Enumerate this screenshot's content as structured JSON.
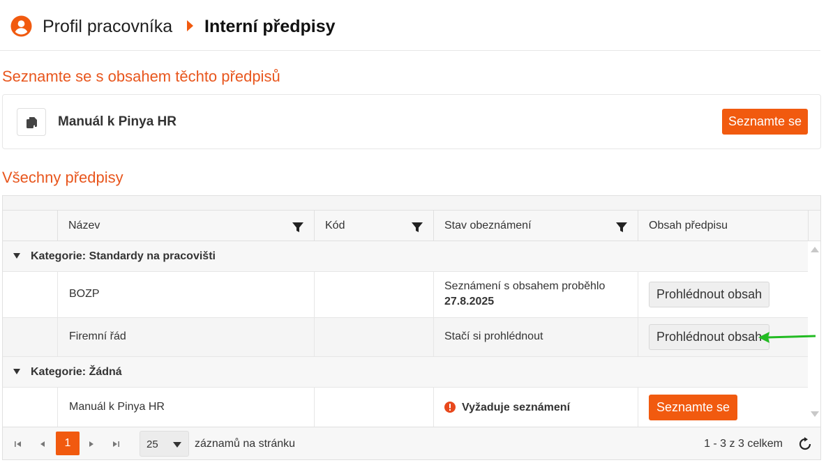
{
  "breadcrumb": {
    "parent": "Profil pracovníka",
    "current": "Interní předpisy"
  },
  "acknowledge_section": {
    "title": "Seznamte se s obsahem těchto předpisů",
    "item_name": "Manuál k Pinya HR",
    "button_label": "Seznamte se"
  },
  "all_section": {
    "title": "Všechny předpisy"
  },
  "grid": {
    "columns": {
      "name": "Název",
      "code": "Kód",
      "state": "Stav obeznámení",
      "content": "Obsah předpisu"
    },
    "groups": [
      {
        "label": "Kategorie: Standardy na pracovišti",
        "rows": [
          {
            "name": "BOZP",
            "code": "",
            "state": "Seznámení s obsahem proběhlo",
            "state_date": "27.8.2025",
            "action": "Prohlédnout obsah"
          },
          {
            "name": "Firemní řád",
            "code": "",
            "state": "Stačí si prohlédnout",
            "state_date": "",
            "action": "Prohlédnout obsah"
          }
        ]
      },
      {
        "label": "Kategorie: Žádná",
        "rows": [
          {
            "name": "Manuál k Pinya HR",
            "code": "",
            "state": "Vyžaduje seznámení",
            "state_date": "",
            "action": "Seznamte se"
          }
        ]
      }
    ]
  },
  "pager": {
    "current_page": "1",
    "page_size": "25",
    "page_size_label": "záznamů na stránku",
    "info": "1 - 3 z 3 celkem"
  },
  "colors": {
    "accent": "#f15a0f",
    "section_title": "#e8561d",
    "annotation_arrow": "#22bb22"
  }
}
